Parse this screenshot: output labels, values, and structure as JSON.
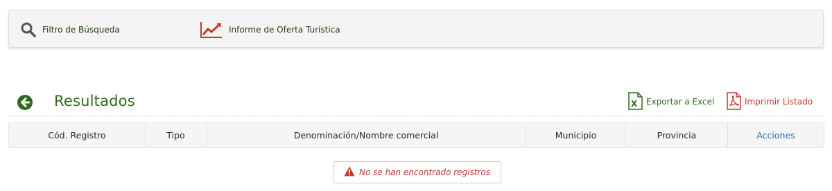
{
  "toolbar": {
    "filter_label": "Filtro de Búsqueda",
    "filter_icon": "search-icon",
    "report_label": "Informe de Oferta Turística",
    "report_icon": "trend-chart-icon"
  },
  "results": {
    "title": "Resultados",
    "back_icon": "arrow-left-circle-icon",
    "export_excel_label": "Exportar a Excel",
    "print_list_label": "Imprimir Listado"
  },
  "table": {
    "headers": [
      "Cód. Registro",
      "Tipo",
      "Denominación/Nombre comercial",
      "Municipio",
      "Provincia",
      "Acciones"
    ]
  },
  "empty_message": "No se han encontrado registros",
  "colors": {
    "green": "#2e6a1b",
    "red": "#c0392b",
    "link_blue": "#2b6fb0"
  }
}
